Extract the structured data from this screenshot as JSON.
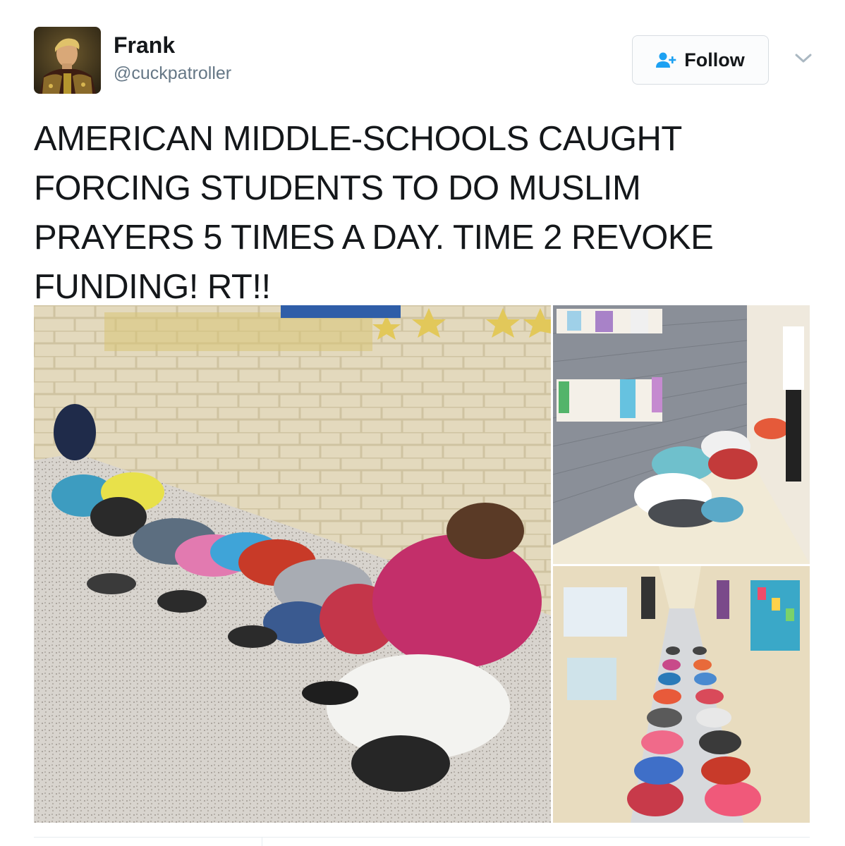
{
  "user": {
    "display_name": "Frank",
    "handle": "@cuckpatroller",
    "avatar_icon": "portrait-avatar"
  },
  "actions": {
    "follow_label": "Follow",
    "follow_icon": "add-user-icon",
    "menu_icon": "chevron-down-icon"
  },
  "tweet": {
    "text": "AMERICAN MIDDLE-SCHOOLS CAUGHT FORCING STUDENTS TO DO MUSLIM PRAYERS 5 TIMES A DAY. TIME 2 REVOKE FUNDING! RT!!"
  },
  "colors": {
    "accent": "#1da1f2",
    "text": "#14171a",
    "secondary": "#657786",
    "border": "#e6ecf0"
  }
}
